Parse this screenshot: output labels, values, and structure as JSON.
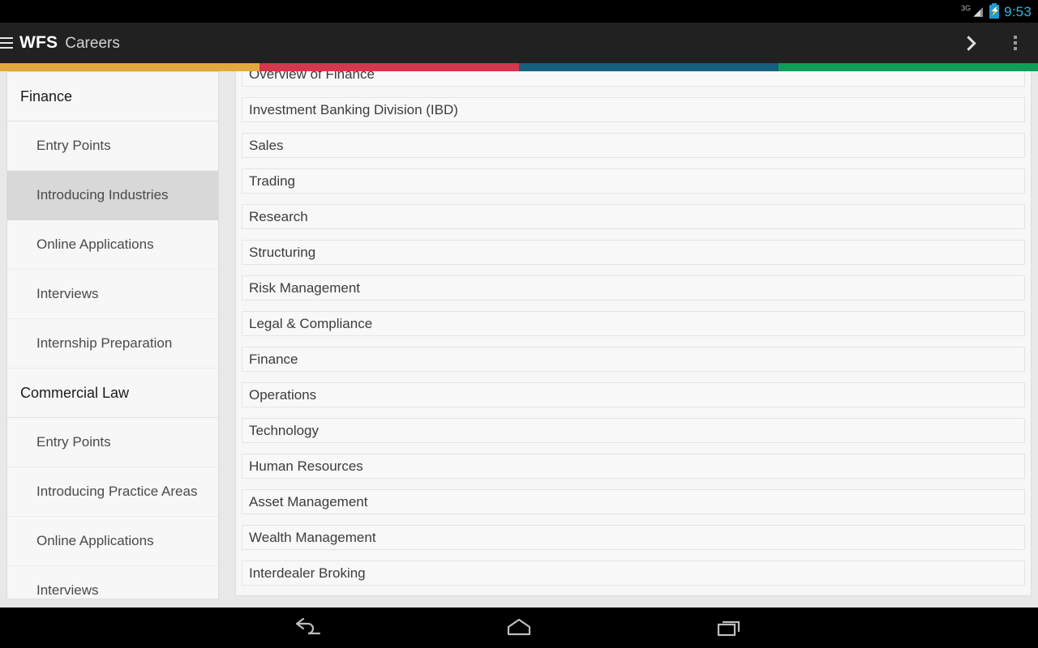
{
  "status_bar": {
    "network_label": "3G",
    "signal_icon": "signal-bars-icon",
    "battery_icon": "battery-charging-icon",
    "time": "9:53"
  },
  "action_bar": {
    "menu_icon": "hamburger-menu-icon",
    "brand": "WFS",
    "section": "Careers",
    "forward_icon": "chevron-right-icon",
    "overflow_icon": "overflow-menu-icon"
  },
  "tab_strip": {
    "segments": [
      {
        "name": "finance-tab",
        "color": "#E2A93E"
      },
      {
        "name": "commercial-law-tab",
        "color": "#D6374B"
      },
      {
        "name": "consulting-tab",
        "color": "#15607F"
      },
      {
        "name": "technology-tab",
        "color": "#0F9D58"
      }
    ]
  },
  "sidebar": {
    "groups": [
      {
        "title": "Finance",
        "items": [
          {
            "label": "Entry Points",
            "selected": false
          },
          {
            "label": "Introducing Industries",
            "selected": true
          },
          {
            "label": "Online Applications",
            "selected": false
          },
          {
            "label": "Interviews",
            "selected": false
          },
          {
            "label": "Internship Preparation",
            "selected": false
          }
        ]
      },
      {
        "title": "Commercial Law",
        "items": [
          {
            "label": "Entry Points",
            "selected": false
          },
          {
            "label": "Introducing Practice Areas",
            "selected": false
          },
          {
            "label": "Online Applications",
            "selected": false
          },
          {
            "label": "Interviews",
            "selected": false
          }
        ]
      }
    ]
  },
  "main": {
    "items": [
      "Overview of Finance",
      "Investment Banking Division (IBD)",
      "Sales",
      "Trading",
      "Research",
      "Structuring",
      "Risk Management",
      "Legal & Compliance",
      "Finance",
      "Operations",
      "Technology",
      "Human Resources",
      "Asset Management",
      "Wealth Management",
      "Interdealer Broking"
    ]
  },
  "nav_bar": {
    "back_icon": "back-arrow-icon",
    "home_icon": "home-icon",
    "recents_icon": "recent-apps-icon"
  }
}
